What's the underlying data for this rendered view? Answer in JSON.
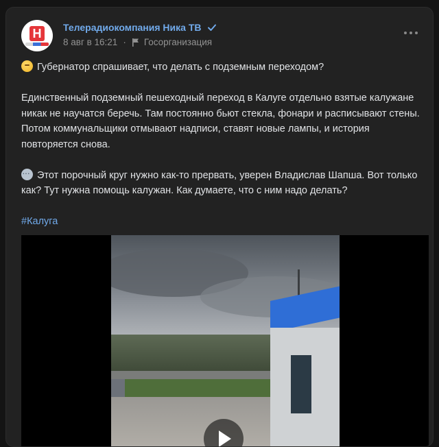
{
  "post": {
    "author": "Телерадиокомпания Ника ТВ",
    "avatar_letter": "Н",
    "date": "8 авг в 16:21",
    "org_label": "Госорганизация",
    "paragraphs": {
      "p1": "Губернатор спрашивает, что делать с подземным переходом?",
      "p2": "Единственный подземный пешеходный переход в Калуге отдельно взятые калужане никак не научатся беречь. Там постоянно бьют стекла, фонари и расписывают стены. Потом коммунальщики отмывают надписи, ставят новые лампы, и история повторяется снова.",
      "p3": "Этот порочный круг нужно как-то прервать, уверен Владислав Шапша. Вот только как? Тут нужна помощь калужан. Как думаете, что с ним надо делать?"
    },
    "hashtag": "#Калуга"
  },
  "icons": {
    "verified": "verified-check-icon",
    "more": "more-dots-icon",
    "flag": "flag-icon",
    "emoji_think": "thinking-face-emoji",
    "emoji_bubble": "speech-bubble-emoji",
    "play": "play-icon"
  },
  "colors": {
    "background": "#141414",
    "card": "#222222",
    "link": "#71aaeb",
    "text": "#e1e3e6",
    "muted": "#939393",
    "logo_red": "#e5363a"
  }
}
